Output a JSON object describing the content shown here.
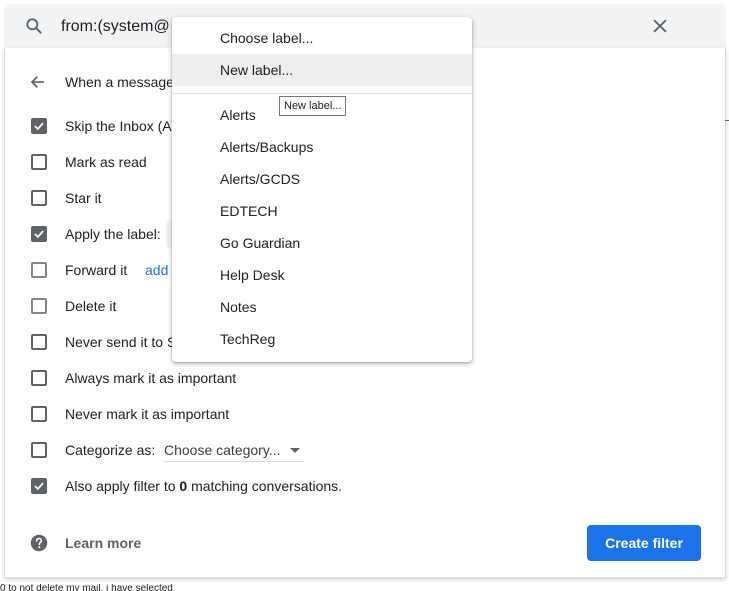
{
  "search": {
    "query": "from:(system@"
  },
  "header": {
    "back_label": "When a message"
  },
  "actions": [
    {
      "label": "Skip the Inbox (A",
      "checked": true
    },
    {
      "label": "Mark as read",
      "checked": false
    },
    {
      "label": "Star it",
      "checked": false
    },
    {
      "label": "Apply the label:",
      "checked": true
    },
    {
      "label": "Forward it",
      "checked": false,
      "link": "add"
    },
    {
      "label": "Delete it",
      "checked": false
    },
    {
      "label": "Never send it to S",
      "checked": false
    },
    {
      "label": "Always mark it as important",
      "checked": false
    },
    {
      "label": "Never mark it as important",
      "checked": false
    },
    {
      "label": "Categorize as:",
      "checked": false
    }
  ],
  "category_select": {
    "value": "Choose category..."
  },
  "also_apply": {
    "prefix": "Also apply filter to ",
    "count": "0",
    "suffix": " matching conversations.",
    "checked": true
  },
  "learn_more": "Learn more",
  "create_filter_label": "Create filter",
  "footer_text": "0 to not delete my mail. i have selected",
  "label_menu": {
    "items": [
      "Choose label...",
      "New label...",
      "Alerts",
      "Alerts/Backups",
      "Alerts/GCDS",
      "EDTECH",
      "Go Guardian",
      "Help Desk",
      "Notes",
      "TechReg"
    ],
    "hovered_index": 1,
    "tooltip": "New label..."
  },
  "icons": {
    "search": "search-icon",
    "close": "close-icon",
    "back": "arrow-back-icon",
    "help": "help-icon",
    "check": "check-icon",
    "dropdown": "chevron-down-icon"
  },
  "colors": {
    "accent": "#1a73e8",
    "checkbox": "#5f6368",
    "searchbar": "#f1f3f4"
  }
}
